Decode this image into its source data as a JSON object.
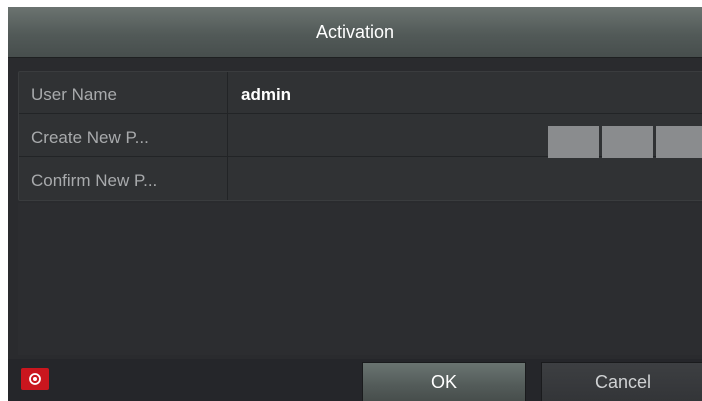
{
  "dialog": {
    "title": "Activation"
  },
  "form": {
    "username_label": "User Name",
    "username_value": "admin",
    "new_password_label": "Create New P...",
    "confirm_password_label": "Confirm New P..."
  },
  "footer": {
    "ok_label": "OK",
    "cancel_label": "Cancel"
  },
  "colors": {
    "power_button": "#c9161e",
    "title_bar": "#5b6361",
    "background": "#2a2b2e"
  },
  "icons": {
    "power": "power-icon"
  }
}
